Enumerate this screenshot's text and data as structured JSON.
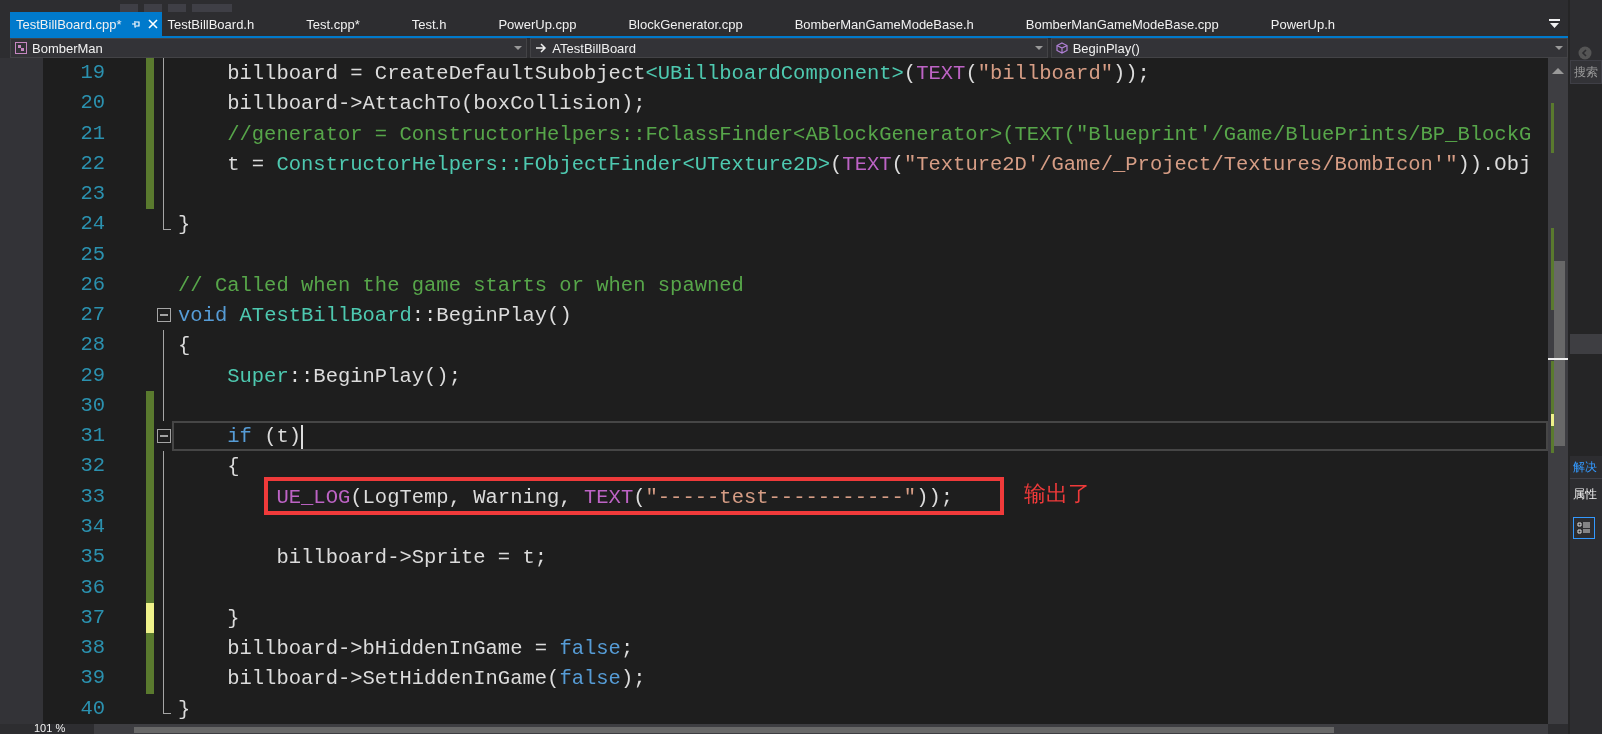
{
  "tabs": [
    {
      "label": "TestBillBoard.cpp*",
      "selected": true
    },
    {
      "label": "TestBillBoard.h",
      "selected": false
    },
    {
      "label": "Test.cpp*",
      "selected": false
    },
    {
      "label": "Test.h",
      "selected": false
    },
    {
      "label": "PowerUp.cpp",
      "selected": false
    },
    {
      "label": "BlockGenerator.cpp",
      "selected": false
    },
    {
      "label": "BomberManGameModeBase.h",
      "selected": false
    },
    {
      "label": "BomberManGameModeBase.cpp",
      "selected": false
    },
    {
      "label": "PowerUp.h",
      "selected": false
    }
  ],
  "navigation": [
    {
      "kind": "project",
      "label": "BomberMan"
    },
    {
      "kind": "class",
      "label": "ATestBillBoard"
    },
    {
      "kind": "method",
      "label": "BeginPlay()"
    }
  ],
  "editor": {
    "annotation": {
      "label": "输出了"
    },
    "zoom_level": "101 %",
    "lines": [
      {
        "number": "19",
        "modified": true,
        "unsaved": false,
        "kind": "inner",
        "tokens": [
          {
            "kind": "plain",
            "text": "    billboard = CreateDefaultSubobject"
          },
          {
            "kind": "type",
            "text": "<UBillboardComponent>"
          },
          {
            "kind": "plain",
            "text": "("
          },
          {
            "kind": "macro",
            "text": "TEXT"
          },
          {
            "kind": "plain",
            "text": "("
          },
          {
            "kind": "string",
            "text": "\"billboard\""
          },
          {
            "kind": "plain",
            "text": "));"
          }
        ]
      },
      {
        "number": "20",
        "modified": true,
        "unsaved": false,
        "kind": "inner",
        "tokens": [
          {
            "kind": "plain",
            "text": "    billboard->AttachTo(boxCollision);"
          }
        ]
      },
      {
        "number": "21",
        "modified": true,
        "unsaved": false,
        "kind": "inner",
        "tokens": [
          {
            "kind": "comment",
            "text": "    //generator = ConstructorHelpers::FClassFinder<ABlockGenerator>(TEXT(\"Blueprint'/Game/BluePrints/BP_BlockG"
          }
        ]
      },
      {
        "number": "22",
        "modified": true,
        "unsaved": false,
        "kind": "inner",
        "tokens": [
          {
            "kind": "plain",
            "text": "    t = "
          },
          {
            "kind": "type",
            "text": "ConstructorHelpers::FObjectFinder<UTexture2D>"
          },
          {
            "kind": "plain",
            "text": "("
          },
          {
            "kind": "macro",
            "text": "TEXT"
          },
          {
            "kind": "plain",
            "text": "("
          },
          {
            "kind": "string",
            "text": "\"Texture2D'/Game/_Project/Textures/BombIcon'\""
          },
          {
            "kind": "plain",
            "text": ")).Obj"
          }
        ]
      },
      {
        "number": "23",
        "modified": true,
        "unsaved": false,
        "kind": "inner"
      },
      {
        "number": "24",
        "modified": false,
        "unsaved": false,
        "kind": "end",
        "tokens": [
          {
            "kind": "plain",
            "text": "}"
          }
        ]
      },
      {
        "number": "25",
        "modified": false,
        "unsaved": false,
        "kind": "outside"
      },
      {
        "number": "26",
        "modified": false,
        "unsaved": false,
        "kind": "outside",
        "tokens": [
          {
            "kind": "comment",
            "text": "// Called when the game starts or when spawned"
          }
        ]
      },
      {
        "number": "27",
        "modified": false,
        "unsaved": false,
        "kind": "collapsible",
        "tokens": [
          {
            "kind": "keyword",
            "text": "void"
          },
          {
            "kind": "type",
            "text": " ATestBillBoard"
          },
          {
            "kind": "plain",
            "text": "::BeginPlay()"
          }
        ]
      },
      {
        "number": "28",
        "modified": false,
        "unsaved": false,
        "kind": "inner",
        "tokens": [
          {
            "kind": "plain",
            "text": "{"
          }
        ]
      },
      {
        "number": "29",
        "modified": false,
        "unsaved": false,
        "kind": "inner",
        "tokens": [
          {
            "kind": "type",
            "text": "    Super"
          },
          {
            "kind": "plain",
            "text": "::BeginPlay();"
          }
        ]
      },
      {
        "number": "30",
        "modified": true,
        "unsaved": false,
        "kind": "inner"
      },
      {
        "number": "31",
        "modified": true,
        "unsaved": false,
        "kind": "collapsible",
        "current": true,
        "tokens": [
          {
            "kind": "keyword",
            "text": "    if"
          },
          {
            "kind": "plain",
            "text": " (t)"
          }
        ]
      },
      {
        "number": "32",
        "modified": true,
        "unsaved": false,
        "kind": "inner",
        "tokens": [
          {
            "kind": "plain",
            "text": "    {"
          }
        ]
      },
      {
        "number": "33",
        "modified": true,
        "unsaved": false,
        "kind": "inner",
        "annotated": true,
        "tokens": [
          {
            "kind": "macro",
            "text": "        UE_LOG"
          },
          {
            "kind": "plain",
            "text": "(LogTemp, Warning, "
          },
          {
            "kind": "macro",
            "text": "TEXT"
          },
          {
            "kind": "plain",
            "text": "("
          },
          {
            "kind": "string",
            "text": "\"-----test-----------\""
          },
          {
            "kind": "plain",
            "text": "));"
          }
        ]
      },
      {
        "number": "34",
        "modified": true,
        "unsaved": false,
        "kind": "inner"
      },
      {
        "number": "35",
        "modified": true,
        "unsaved": false,
        "kind": "inner",
        "tokens": [
          {
            "kind": "plain",
            "text": "        billboard->Sprite = t;"
          }
        ]
      },
      {
        "number": "36",
        "modified": true,
        "unsaved": false,
        "kind": "inner"
      },
      {
        "number": "37",
        "modified": true,
        "unsaved": true,
        "kind": "inner",
        "tokens": [
          {
            "kind": "plain",
            "text": "    }"
          }
        ]
      },
      {
        "number": "38",
        "modified": true,
        "unsaved": false,
        "kind": "inner",
        "tokens": [
          {
            "kind": "plain",
            "text": "    billboard->bHiddenInGame = "
          },
          {
            "kind": "keyword",
            "text": "false"
          },
          {
            "kind": "plain",
            "text": ";"
          }
        ]
      },
      {
        "number": "39",
        "modified": true,
        "unsaved": false,
        "kind": "inner",
        "tokens": [
          {
            "kind": "plain",
            "text": "    billboard->SetHiddenInGame("
          },
          {
            "kind": "keyword",
            "text": "false"
          },
          {
            "kind": "plain",
            "text": ");"
          }
        ]
      },
      {
        "number": "40",
        "modified": false,
        "unsaved": false,
        "kind": "end",
        "tokens": [
          {
            "kind": "plain",
            "text": "}"
          }
        ]
      }
    ]
  },
  "side_panel": {
    "search_placeholder": "搜索",
    "tabs": [
      {
        "label": "解决",
        "selected": true
      }
    ],
    "properties_title": "属性"
  }
}
